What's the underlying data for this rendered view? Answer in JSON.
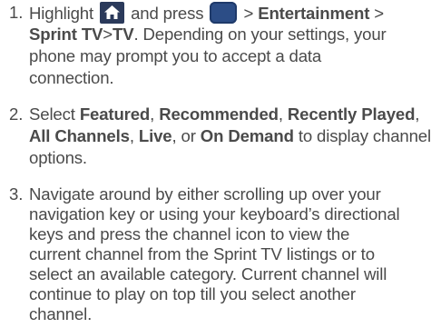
{
  "steps": [
    {
      "num": "1.",
      "t1": "Highlight",
      "home_icon": "home-key-icon",
      "t2": "and press",
      "menu_icon": "menu-key-icon",
      "sep1": ">",
      "b1": "Entertainment",
      "sep2": ">",
      "b2": "Sprint TV",
      "sep3": ">",
      "b3": "TV",
      "t3": ". Depending on your settings, your",
      "l2": "phone may prompt you to accept a data",
      "l3": "connection."
    },
    {
      "num": "2.",
      "t1": "Select",
      "b1": "Featured",
      "c1": ",",
      "b2": "Recommended",
      "c2": ",",
      "b3": "Recently Played",
      "c3": ",",
      "b4": "All Channels",
      "c4": ",",
      "b5": "Live",
      "t2": ", or",
      "b6": "On Demand",
      "t3": "to display channel",
      "l3": "options."
    },
    {
      "num": "3.",
      "lines": [
        "Navigate around by either scrolling up over your",
        "navigation key or using your keyboard’s directional",
        "keys and press the channel icon to view the",
        "current channel from the Sprint TV listings or to",
        "select an available category. Current channel will",
        "continue to play on top till you select another",
        "channel."
      ]
    }
  ],
  "colors": {
    "text": "#4a4a4a",
    "home_key": "#2b3a5b",
    "menu_key": "#2c4d86"
  }
}
